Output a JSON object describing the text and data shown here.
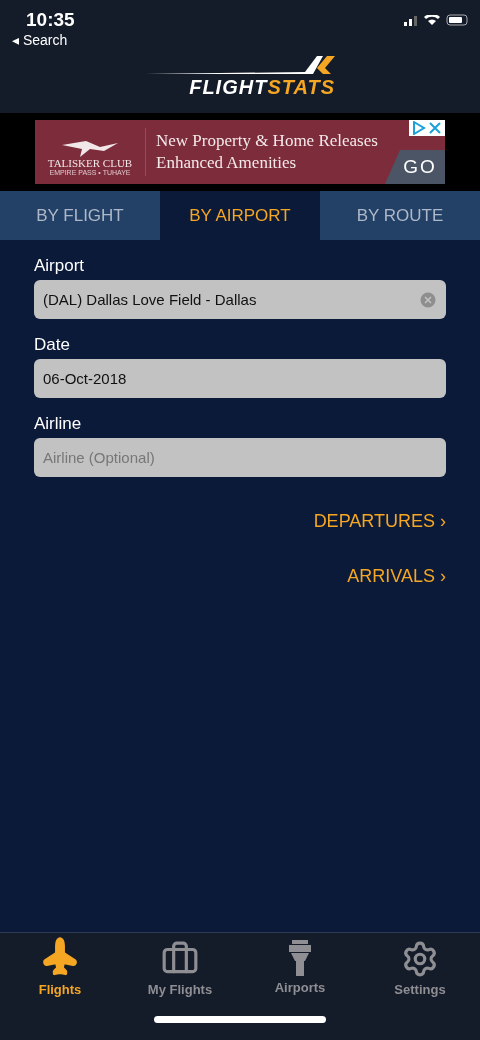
{
  "status_bar": {
    "time": "10:35",
    "back_arrow": "◂",
    "back_label": "Search"
  },
  "logo": {
    "part_1": "FLIGHT",
    "part_2": "STATS"
  },
  "ad": {
    "brand": "TALISKER CLUB",
    "brand_sub": "EMPIRE PASS • TUHAYE",
    "line_1": "New Property & Home Releases",
    "line_2": "Enhanced Amenities",
    "cta": "GO"
  },
  "tabs": [
    {
      "label": "BY FLIGHT",
      "selected": false
    },
    {
      "label": "BY AIRPORT",
      "selected": true
    },
    {
      "label": "BY ROUTE",
      "selected": false
    }
  ],
  "fields": [
    {
      "label": "Airport",
      "value": "(DAL) Dallas Love Field - Dallas",
      "clearable": true
    },
    {
      "label": "Date",
      "value": "06-Oct-2018",
      "clearable": false
    },
    {
      "label": "Airline",
      "placeholder": "Airline (Optional)",
      "clearable": false
    }
  ],
  "links": [
    {
      "label": "DEPARTURES",
      "chevron": "›"
    },
    {
      "label": "ARRIVALS",
      "chevron": "›"
    }
  ],
  "tab_bar": [
    {
      "kind": "plane",
      "label": "Flights",
      "selected": true
    },
    {
      "kind": "suitcase",
      "label": "My Flights",
      "selected": false
    },
    {
      "kind": "tower",
      "label": "Airports",
      "selected": false
    },
    {
      "kind": "gear",
      "label": "Settings",
      "selected": false
    }
  ]
}
